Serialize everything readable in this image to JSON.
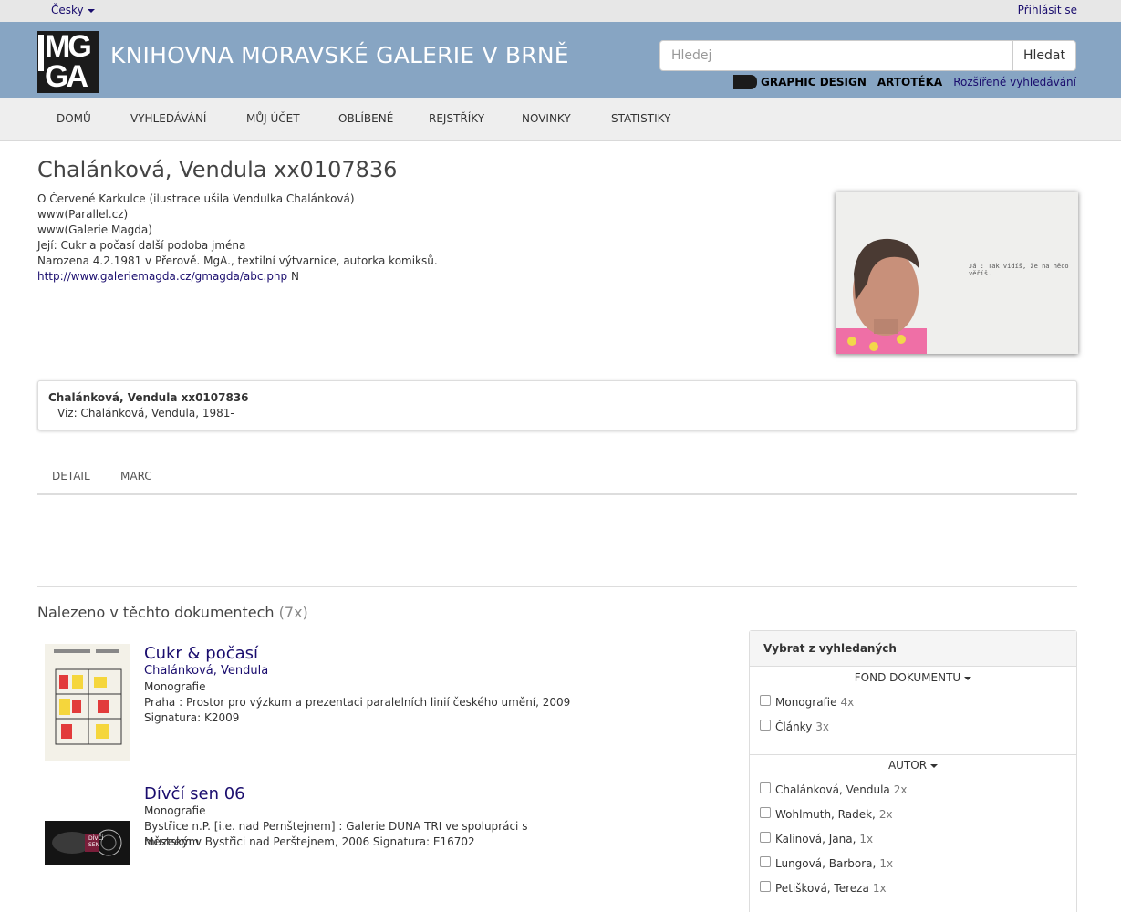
{
  "topbar": {
    "language": "Česky",
    "login": "Přihlásit se"
  },
  "header": {
    "logo_text_top": "MG",
    "logo_text_bottom": "GA",
    "title": "KNIHOVNA MORAVSKÉ GALERIE V BRNĚ",
    "search_placeholder": "Hledej",
    "search_button": "Hledat",
    "links": {
      "graphic_design": "GRAPHIC DESIGN",
      "artoteka": "ARTOTÉKA",
      "advanced": "Rozšířené vyhledávání"
    }
  },
  "nav": [
    "DOMŮ",
    "VYHLEDÁVÁNÍ",
    "MŮJ ÚČET",
    "OBLÍBENÉ",
    "REJSTŘÍKY",
    "NOVINKY",
    "STATISTIKY"
  ],
  "record": {
    "title": "Chalánková, Vendula xx0107836",
    "lines": [
      "O Červené Karkulce (ilustrace ušila Vendulka Chalánková)",
      "www(Parallel.cz)",
      "www(Galerie Magda)",
      "Její: Cukr a počasí další podoba jména",
      "Narozena 4.2.1981 v Přerově. MgA., textilní výtvarnice, autorka komiksů."
    ],
    "url": "http://www.galeriemagda.cz/gmagda/abc.php",
    "url_suffix": "N",
    "photo_caption": "Já : Tak vidíš, že na něco věříš."
  },
  "see_also": {
    "title": "Chalánková, Vendula xx0107836",
    "reference": "Viz: Chalánková, Vendula, 1981-"
  },
  "tabs": [
    "DETAIL",
    "MARC"
  ],
  "found": {
    "heading": "Nalezeno v těchto dokumentech",
    "count": "(7x)"
  },
  "results": [
    {
      "title": "Cukr & počasí",
      "author": "Chalánková, Vendula",
      "type": "Monografie",
      "publisher": "Praha : Prostor pro výzkum a prezentaci paralelních linií českého umění, 2009",
      "signature": "Signatura: K2009"
    },
    {
      "title": "Dívčí sen 06",
      "type": "Monografie",
      "publisher_line1": "Bystřice n.P. [i.e. nad Pernštejnem] : Galerie DUNA TRI ve spolupráci s Městským",
      "publisher_line2": "muzeem v Bystřici nad Perštejnem, 2006 Signatura: E16702",
      "thumb_text": "DÍVČÍ SEN"
    }
  ],
  "facets": {
    "heading": "Vybrat z vyhledaných",
    "groups": [
      {
        "title": "FOND DOKUMENTU",
        "items": [
          {
            "label": "Monografie",
            "count": "4x"
          },
          {
            "label": "Články",
            "count": "3x"
          }
        ]
      },
      {
        "title": "AUTOR",
        "items": [
          {
            "label": "Chalánková, Vendula",
            "count": "2x"
          },
          {
            "label": "Wohlmuth, Radek,",
            "count": "2x"
          },
          {
            "label": "Kalinová, Jana,",
            "count": "1x"
          },
          {
            "label": "Lungová, Barbora,",
            "count": "1x"
          },
          {
            "label": "Petišková, Tereza",
            "count": "1x"
          }
        ]
      }
    ]
  }
}
